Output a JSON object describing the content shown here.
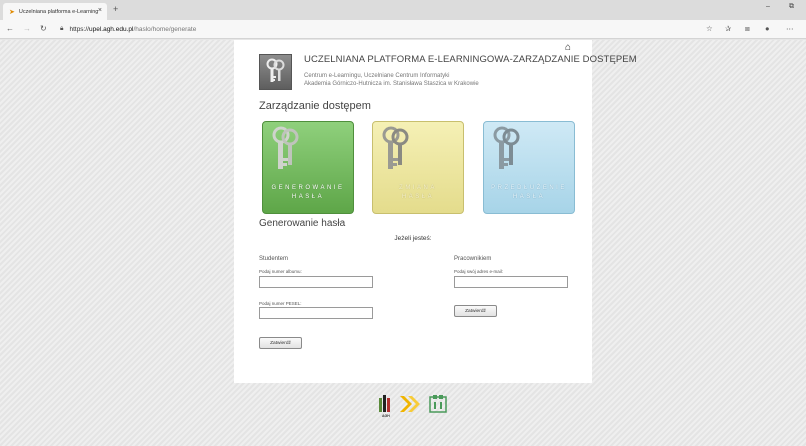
{
  "browser": {
    "tab_title": "Uczelniana platforma e-Learning",
    "tab_close": "×",
    "new_tab": "+",
    "url_scheme": "https://",
    "url_host": "upel.agh.edu.pl",
    "url_path": "/haslo/home/generate"
  },
  "header": {
    "title": "UCZELNIANA PLATFORMA E-LEARNINGOWA-ZARZĄDZANIE DOSTĘPEM",
    "line1": "Centrum e-Learningu, Uczelniane Centrum Informatyki",
    "line2": "Akademia Górniczo-Hutnicza im. Stanisława Staszica w Krakowie"
  },
  "section_title": "Zarządzanie dostępem",
  "cards": [
    {
      "label_1": "GENEROWANIE",
      "label_2": "HASŁA",
      "color": "#6fb857"
    },
    {
      "label_1": "ZMIANA",
      "label_2": "HASŁA",
      "color": "#ebe49e"
    },
    {
      "label_1": "PRZEDŁUŻENIE",
      "label_2": "HASŁA",
      "color": "#b9def0"
    }
  ],
  "form": {
    "title": "Generowanie hasła",
    "prompt": "Jeżeli jesteś:",
    "student": {
      "heading": "Studentem",
      "album_label": "Podaj numer albumu:",
      "album_value": "",
      "pesel_label": "Podaj numer PESEL:",
      "pesel_value": "",
      "submit": "Zatwierdź"
    },
    "employee": {
      "heading": "Pracownikiem",
      "email_label": "Podaj swój adres e-mail:",
      "email_value": "",
      "submit": "Zatwierdź"
    }
  },
  "footer": {
    "agh_label": "AGH"
  }
}
